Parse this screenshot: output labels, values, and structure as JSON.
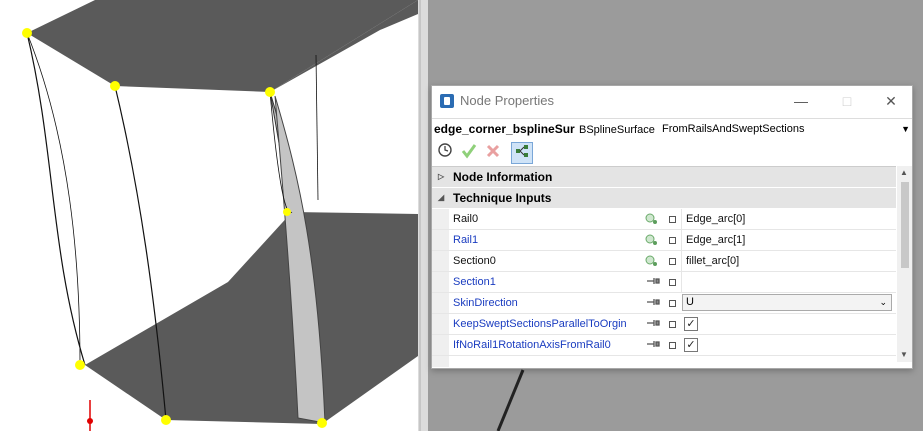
{
  "window": {
    "title": "Node Properties",
    "min_glyph": "—",
    "max_glyph": "□",
    "close_glyph": "✕"
  },
  "node": {
    "name": "edge_corner_bsplineSur",
    "type": "BSplineSurface",
    "technique": "FromRailsAndSweptSections"
  },
  "toolbar": {
    "icons": [
      "history-icon",
      "apply-check-icon",
      "cancel-x-icon",
      "dependency-graph-icon"
    ]
  },
  "sections": {
    "node_information": "Node Information",
    "technique_inputs": "Technique Inputs"
  },
  "inputs": [
    {
      "name": "Rail0",
      "value": "Edge_arc[0]"
    },
    {
      "name": "Rail1",
      "value": "Edge_arc[1]"
    },
    {
      "name": "Section0",
      "value": "fillet_arc[0]"
    },
    {
      "name": "Section1",
      "value": ""
    },
    {
      "name": "SkinDirection",
      "value": "U"
    },
    {
      "name": "KeepSweptSectionsParallelToOrgin",
      "value": "checked"
    },
    {
      "name": "IfNoRail1RotationAxisFromRail0",
      "value": "checked"
    }
  ],
  "colors": {
    "surface": "#5a5a5a",
    "vertex": "#ffff00",
    "viewport_bg": "#9b9b9b"
  }
}
